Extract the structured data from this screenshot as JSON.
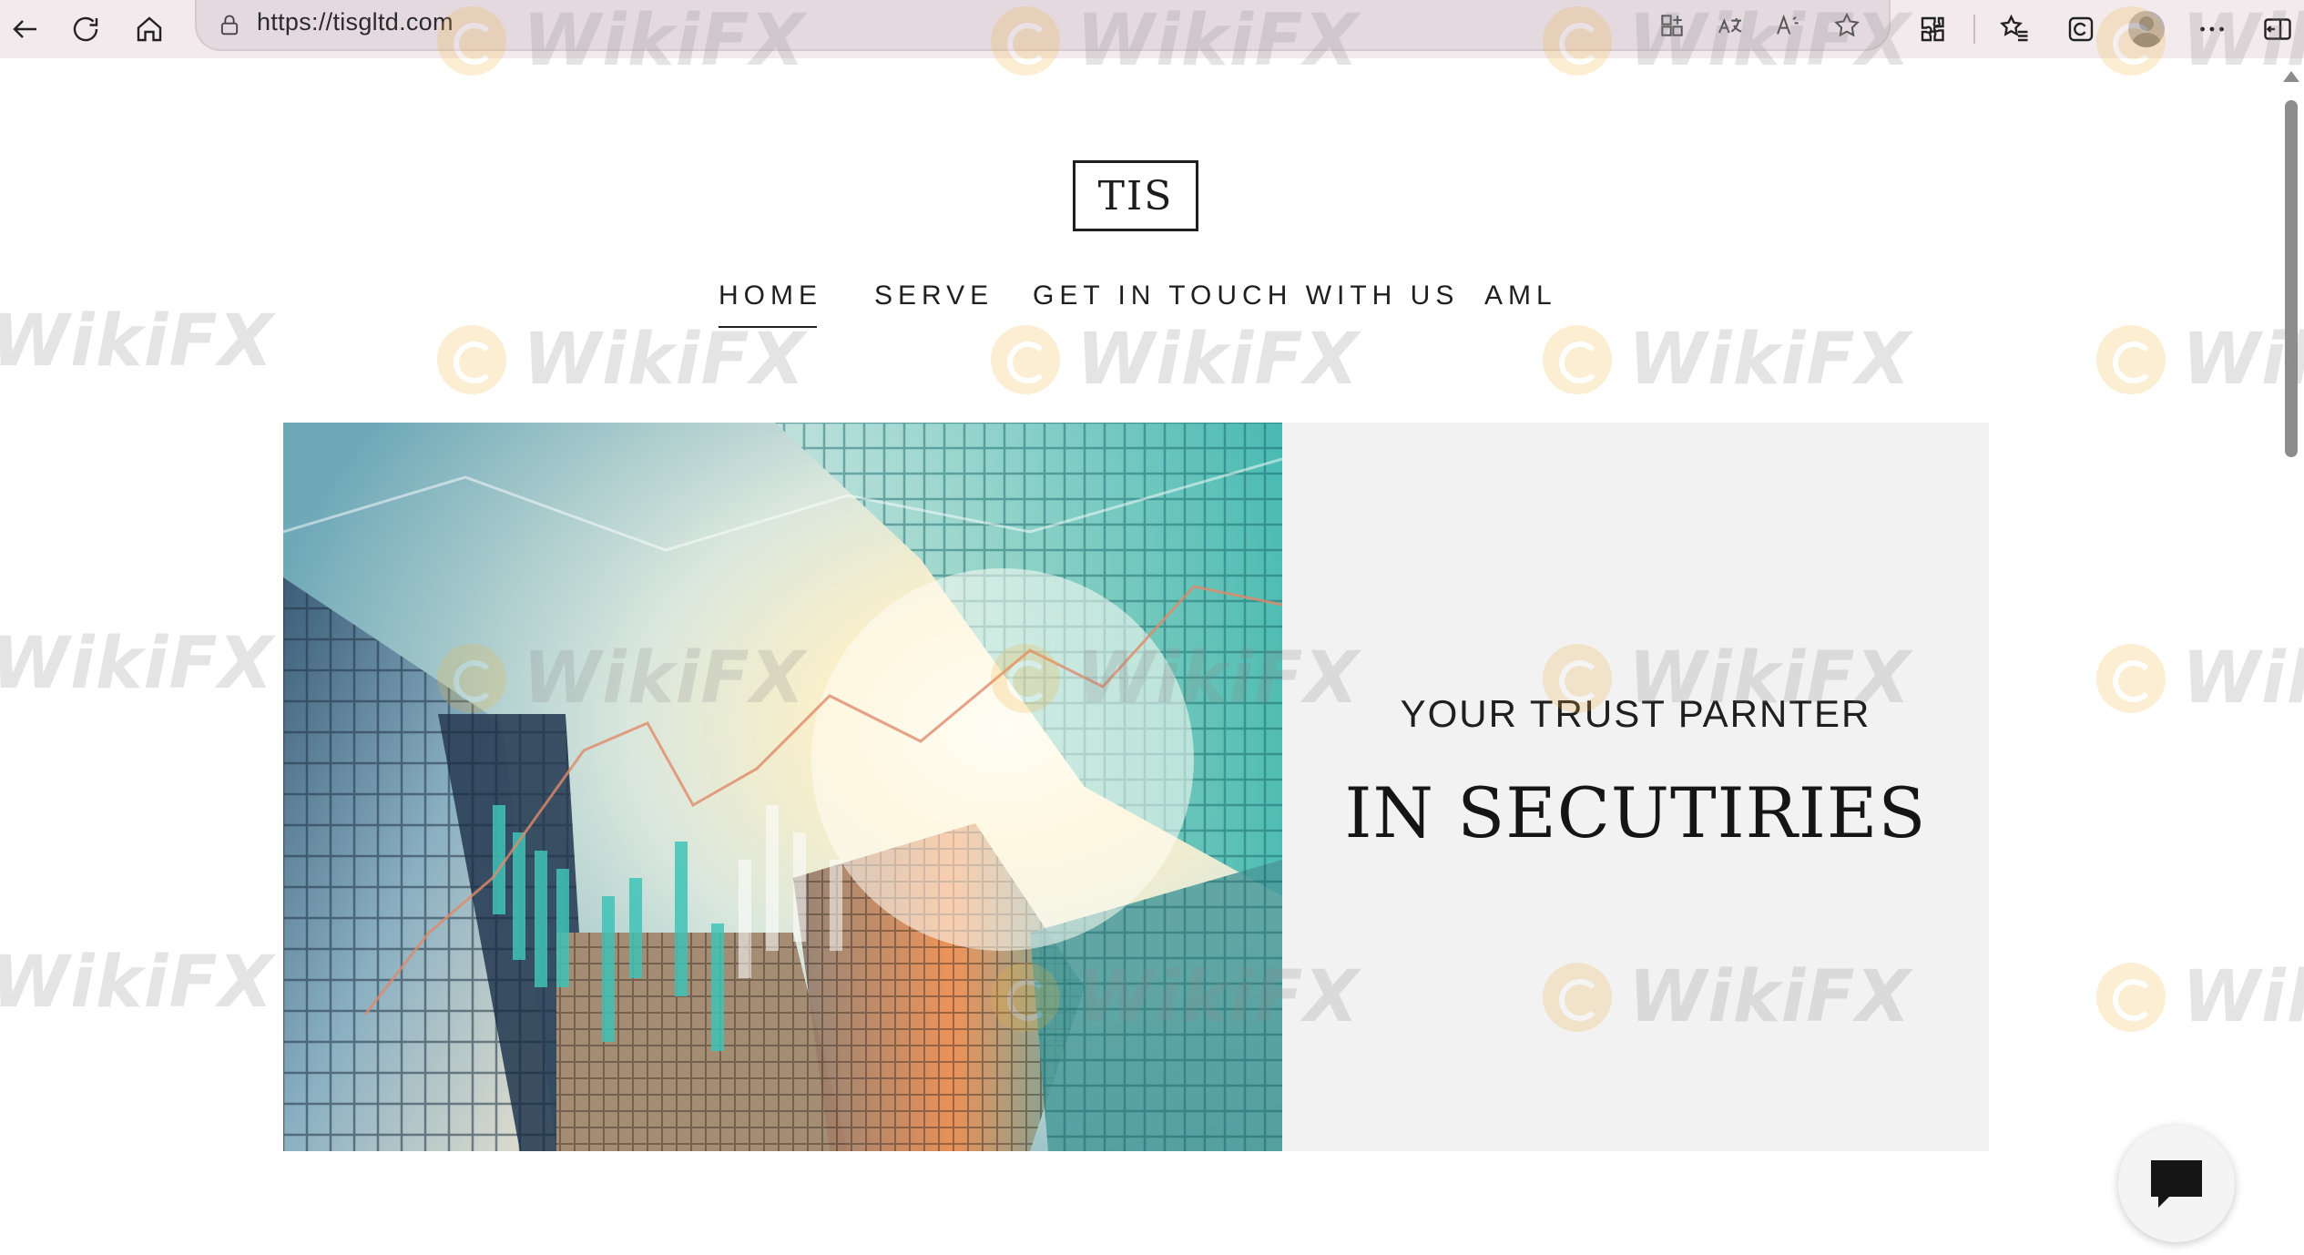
{
  "browser": {
    "url": "https://tisgltd.com",
    "icons": [
      "back-icon",
      "refresh-icon",
      "home-icon",
      "lock-icon",
      "apps-icon",
      "translate-icon",
      "read-aloud-icon",
      "favorite-star-icon",
      "extensions-icon",
      "favorites-icon",
      "collections-icon",
      "profile-icon",
      "more-icon",
      "sidebar-icon"
    ]
  },
  "site": {
    "logo": "TIS",
    "nav": [
      {
        "label": "HOME",
        "active": true
      },
      {
        "label": "SERVE",
        "active": false
      },
      {
        "label": "GET IN TOUCH WITH US",
        "active": false
      },
      {
        "label": "AML",
        "active": false
      }
    ],
    "hero": {
      "tagline_small": "YOUR TRUST PARNTER",
      "tagline_big": "IN SECUTIRIES",
      "image": "skyscrapers-chart-image"
    }
  },
  "chat": {
    "icon": "chat-icon"
  },
  "watermark": {
    "text": "WikiFX"
  }
}
